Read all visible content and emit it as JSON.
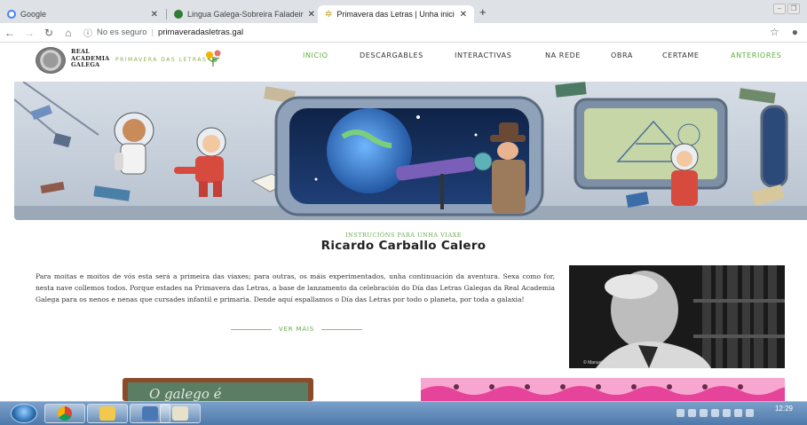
{
  "browser": {
    "tabs": [
      {
        "title": "Google",
        "favicon_color": "#4285f4"
      },
      {
        "title": "Lingua Galega-Sobreira Faladeir",
        "favicon_color": "#2e7d32"
      },
      {
        "title": "Primavera das Letras | Unha inici",
        "favicon_color": "#c9a227"
      }
    ],
    "active_tab_index": 2,
    "new_tab_label": "+",
    "security_label": "No es seguro",
    "url": "primaveradasletras.gal"
  },
  "site": {
    "academy_lines": [
      "REAL",
      "ACADEMIA",
      "GALEGA"
    ],
    "program_logo_text": "PRIMAVERA DAS LETRAS",
    "menu": [
      {
        "label": "INICIO",
        "active": true
      },
      {
        "label": "DESCARGABLES",
        "active": false
      },
      {
        "label": "INTERACTIVAS",
        "active": false
      },
      {
        "label": "NA REDE",
        "active": false
      },
      {
        "label": "OBRA",
        "active": false
      },
      {
        "label": "CERTAME",
        "active": false
      },
      {
        "label": "ANTERIORES",
        "active": true
      }
    ]
  },
  "article": {
    "kicker": "INSTRUCIÓNS PARA UNHA VIAXE",
    "title": "Ricardo Carballo Calero",
    "body": "Para moitas e moitos de vós esta será a primeira das viaxes; para outras, os máis experimentados, unha continuación da aventura. Sexa como for, nesta nave collemos todos. Porque estades na Primavera das Letras, a base de lanzamento da celebración do Día das Letras Galegas da Real Academia Galega para os nenos e nenas que cursades infantil e primaria. Dende aquí espallamos o Día das Letras por todo o planeta, por toda a galaxia!",
    "read_more": "VER MÁIS",
    "photo_credit": "© Manuel Ramos"
  },
  "bottom": {
    "chalk_text": "O galego é"
  },
  "taskbar": {
    "clock": "12:29"
  },
  "colors": {
    "accent_green": "#5fae3e",
    "hero_blue": "#b9c7d8",
    "taskbar_blue": "#5b86b8"
  }
}
